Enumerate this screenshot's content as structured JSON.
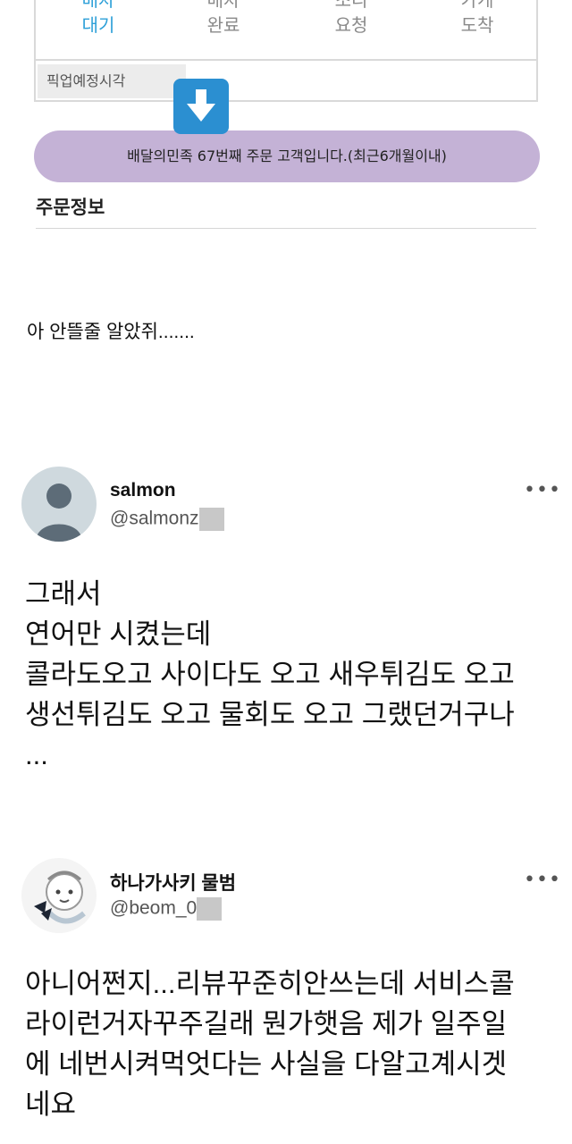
{
  "delivery_app": {
    "status_tabs": [
      {
        "line1": "배차",
        "line2": "대기"
      },
      {
        "line1": "배차",
        "line2": "완료"
      },
      {
        "line1": "조리",
        "line2": "요청"
      },
      {
        "line1": "가게",
        "line2": "도착"
      }
    ],
    "pickup_label": "픽업예정시각",
    "order_banner": "배달의민족 67번째 주문 고객입니다.(최근6개월이내)",
    "section_title": "주문정보",
    "accent_color": "#2ea0d8",
    "banner_color": "#c4b2d6"
  },
  "caption": "아 안뜰줄 알았쥐.......",
  "tweets": [
    {
      "name": "salmon",
      "handle": "@salmonz",
      "lines": [
        "그래서",
        "연어만 시켰는데",
        "콜라도오고 사이다도 오고 새우튀김도 오고",
        "생선튀김도 오고 물회도 오고 그랬던거구나",
        "..."
      ]
    },
    {
      "name": "하나가사키 물범",
      "handle": "@beom_0",
      "lines": [
        "아니어쩐지...리뷰꾸준히안쓰는데 서비스콜",
        "라이런거자꾸주길래 뭔가햇음 제가 일주일",
        "에 네번시켜먹엇다는 사실을 다알고계시겟",
        "네요"
      ]
    }
  ]
}
